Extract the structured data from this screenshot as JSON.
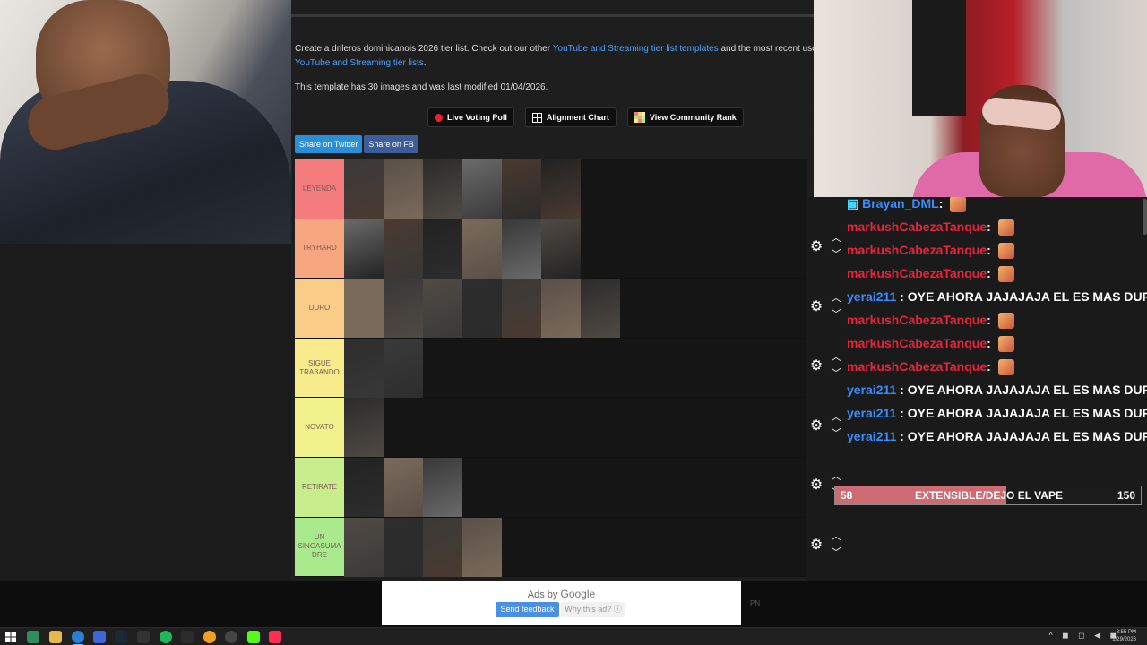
{
  "page": {
    "desc_part1": "Create a drileros dominicanois 2026 tier list. Check out our other ",
    "desc_link1": "YouTube and Streaming tier list templates",
    "desc_part2": " and the most recent user subm",
    "desc_link2": "YouTube and Streaming tier lists",
    "desc_end": ".",
    "modified": "This template has 30 images and was last modified 01/04/2026.",
    "actions": {
      "poll": "Live Voting Poll",
      "alignment": "Alignment Chart",
      "community": "View Community Rank"
    },
    "share_twitter": "Share on Twitter",
    "share_fb": "Share on FB"
  },
  "tiers": [
    {
      "label": "LEYENDA",
      "color": "#f47c7c",
      "count": 6
    },
    {
      "label": "TRYHARD",
      "color": "#f6a77f",
      "count": 6
    },
    {
      "label": "DURO",
      "color": "#f9cc88",
      "count": 7
    },
    {
      "label": "SIGUE TRABANDO",
      "color": "#f8eb8b",
      "count": 2
    },
    {
      "label": "NOVATO",
      "color": "#f1f28b",
      "count": 1
    },
    {
      "label": "RETIRATE",
      "color": "#c9ec8c",
      "count": 3
    },
    {
      "label": "UN SINGASUMA DRE",
      "color": "#a9ea8c",
      "count": 4
    }
  ],
  "chat": [
    {
      "user": "Brayan_DML",
      "sep": ": ",
      "msg": "",
      "color": "blue",
      "emote": true,
      "badge": true
    },
    {
      "user": "markushCabezaTanque",
      "sep": ": ",
      "msg": "",
      "color": "red",
      "emote": true
    },
    {
      "user": "markushCabezaTanque",
      "sep": ": ",
      "msg": "",
      "color": "red",
      "emote": true
    },
    {
      "user": "markushCabezaTanque",
      "sep": ": ",
      "msg": "",
      "color": "red",
      "emote": true
    },
    {
      "user": "yerai211",
      "sep": " : ",
      "msg": "OYE AHORA JAJAJAJA EL ES MAS DURO Q",
      "color": "blue",
      "emote": false
    },
    {
      "user": "markushCabezaTanque",
      "sep": ": ",
      "msg": "",
      "color": "red",
      "emote": true
    },
    {
      "user": "markushCabezaTanque",
      "sep": ": ",
      "msg": "",
      "color": "red",
      "emote": true
    },
    {
      "user": "markushCabezaTanque",
      "sep": ": ",
      "msg": "",
      "color": "red",
      "emote": true
    },
    {
      "user": "yerai211",
      "sep": " : ",
      "msg": "OYE AHORA JAJAJAJA EL ES MAS DURO Q",
      "color": "blue",
      "emote": false
    },
    {
      "user": "yerai211",
      "sep": " : ",
      "msg": "OYE AHORA JAJAJAJA EL ES MAS DURO Q",
      "color": "blue",
      "emote": false
    },
    {
      "user": "yerai211",
      "sep": " : ",
      "msg": "OYE AHORA JAJAJAJA EL ES MAS DURO Q",
      "color": "blue",
      "emote": false
    }
  ],
  "poll": {
    "left_value": "58",
    "title": "EXTENSIBLE/DEJO EL VAPE",
    "right_value": "150",
    "fraction": 0.56
  },
  "ad": {
    "ads_by": "Ads by",
    "brand": "Google",
    "send_feedback": "Send feedback",
    "why": "Why this ad? ⓘ"
  },
  "pn_text": "PN",
  "clock": {
    "time": "8:55 PM",
    "date": "1/29/2026"
  },
  "colors": {
    "link": "#4aa3ff",
    "red_user": "#e8243b",
    "blue_user": "#3a8dff"
  }
}
